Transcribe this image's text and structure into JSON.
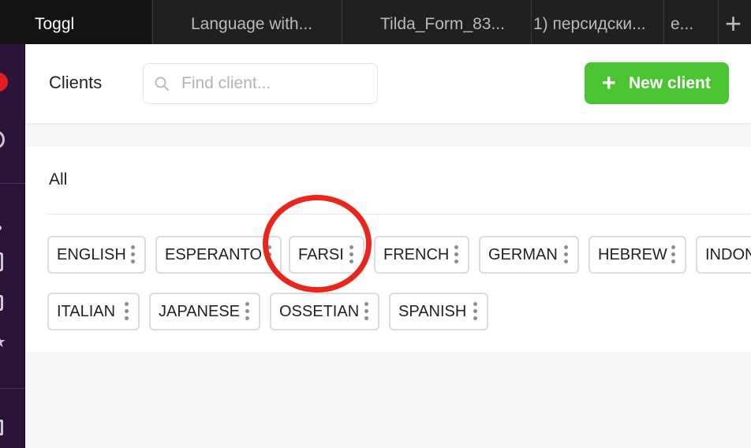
{
  "browser": {
    "tabs": [
      {
        "label": "Toggl",
        "active": true
      },
      {
        "label": "Language with...",
        "active": false
      },
      {
        "label": "Tilda_Form_83...",
        "active": false
      },
      {
        "label": "1) персидски...",
        "active": false
      },
      {
        "label": "e...",
        "active": false
      }
    ],
    "new_tab_label": "+"
  },
  "sidebar": {
    "icons": [
      "toggl-logo-icon",
      "timer-icon",
      "dot-icon",
      "document-icon",
      "checkbox-icon",
      "star-icon",
      "grid-icon"
    ]
  },
  "header": {
    "title": "Clients",
    "search": {
      "placeholder": "Find client...",
      "value": ""
    },
    "new_button": {
      "label": "New client",
      "icon": "+"
    }
  },
  "clients": {
    "group_title": "All",
    "chips": [
      "ENGLISH",
      "ESPERANTO",
      "FARSI",
      "FRENCH",
      "GERMAN",
      "HEBREW",
      "INDONESIAN",
      "ITALIAN",
      "JAPANESE",
      "OSSETIAN",
      "SPANISH"
    ]
  },
  "colors": {
    "accent_green": "#4bc432",
    "sidebar_purple": "#2c1338",
    "annotation_red": "#e8261c"
  }
}
